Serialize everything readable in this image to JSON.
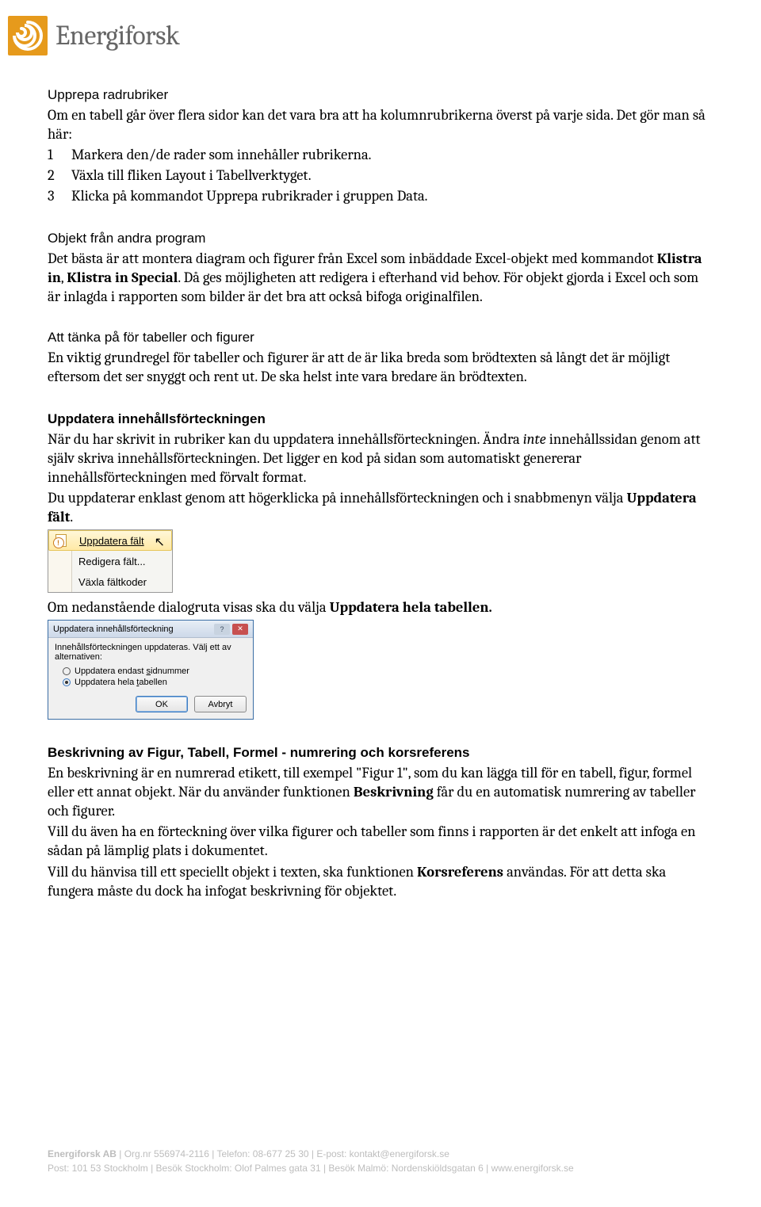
{
  "logo_text": "Energiforsk",
  "sections": {
    "s1": {
      "heading": "Upprepa radrubriker",
      "p1": "Om en tabell går över flera sidor kan det vara bra att ha kolumnrubrikerna överst på varje sida. Det gör man så här:",
      "l1": "Markera den/de rader som innehåller rubrikerna.",
      "l2a": "Växla till fliken ",
      "l2b": "Layout",
      "l2c": " i Tabellverktyget.",
      "l3a": "Klicka på kommandot ",
      "l3b": "Upprepa rubrikrader",
      "l3c": " i gruppen ",
      "l3d": "Data",
      "l3e": "."
    },
    "s2": {
      "heading": "Objekt från andra program",
      "p1a": "Det bästa är att montera diagram och figurer från Excel som inbäddade Excel-objekt med kommandot ",
      "p1b": "Klistra in",
      "p1c": ", ",
      "p1d": "Klistra in Special",
      "p1e": ". Då ges möjligheten att redigera i efterhand vid behov. För objekt gjorda i Excel och som är inlagda i rapporten som bilder är det bra att också bifoga originalfilen."
    },
    "s3": {
      "heading": "Att tänka på för tabeller och figurer",
      "p1": "En viktig grundregel för tabeller och figurer är att de är lika breda som brödtexten så långt det är möjligt eftersom det ser snyggt och rent ut. De ska helst inte vara bredare än brödtexten."
    },
    "s4": {
      "heading": "Uppdatera innehållsförteckningen",
      "p1a": "När du har skrivit in rubriker kan du uppdatera innehållsförteckningen. Ändra ",
      "p1b": "inte",
      "p1c": " innehållssidan genom att själv skriva innehållsförteckningen. Det ligger en kod på sidan som automatiskt genererar innehållsförteckningen med förvalt format.",
      "p2a": "Du uppdaterar enklast genom att högerklicka på innehållsförteckningen och i snabbmenyn välja ",
      "p2b": "Uppdatera fält",
      "p2c": "."
    },
    "context_menu": {
      "m1": "Uppdatera fält",
      "m2": "Redigera fält...",
      "m3": "Växla fältkoder"
    },
    "s4post": {
      "p1a": "Om nedanstående dialogruta visas ska du välja ",
      "p1b": "Uppdatera hela tabellen.",
      "p1c": ""
    },
    "dialog": {
      "title": "Uppdatera innehållsförteckning",
      "msg": "Innehållsförteckningen uppdateras. Välj ett av alternativen:",
      "opt1": "Uppdatera endast ",
      "opt1u": "s",
      "opt1b": "idnummer",
      "opt2": "Uppdatera hela ",
      "opt2u": "t",
      "opt2b": "abellen",
      "ok": "OK",
      "cancel": "Avbryt"
    },
    "s5": {
      "heading": "Beskrivning av Figur, Tabell, Formel - numrering och korsreferens",
      "p1a": "En beskrivning är en numrerad etikett, till exempel \"Figur 1\", som du kan lägga till för en tabell, figur, formel eller ett annat objekt. När du använder funktionen ",
      "p1b": "Beskrivning",
      "p1c": " får du en automatisk numrering av tabeller och figurer.",
      "p2": "Vill du även ha en förteckning över vilka figurer och tabeller som finns i rapporten är det enkelt att infoga en sådan på lämplig plats i dokumentet.",
      "p3a": "Vill du hänvisa till ett speciellt objekt i texten, ska funktionen ",
      "p3b": "Korsreferens",
      "p3c": " användas. För att detta ska fungera måste du dock ha infogat beskrivning för objektet."
    }
  },
  "footer": {
    "l1": "Energiforsk AB | Org.nr 556974-2116 | Telefon: 08-677 25 30 | E-post: kontakt@energiforsk.se",
    "l2": "Post: 101 53 Stockholm | Besök Stockholm: Olof Palmes gata 31 | Besök Malmö: Nordenskiöldsgatan 6 | www.energiforsk.se"
  }
}
